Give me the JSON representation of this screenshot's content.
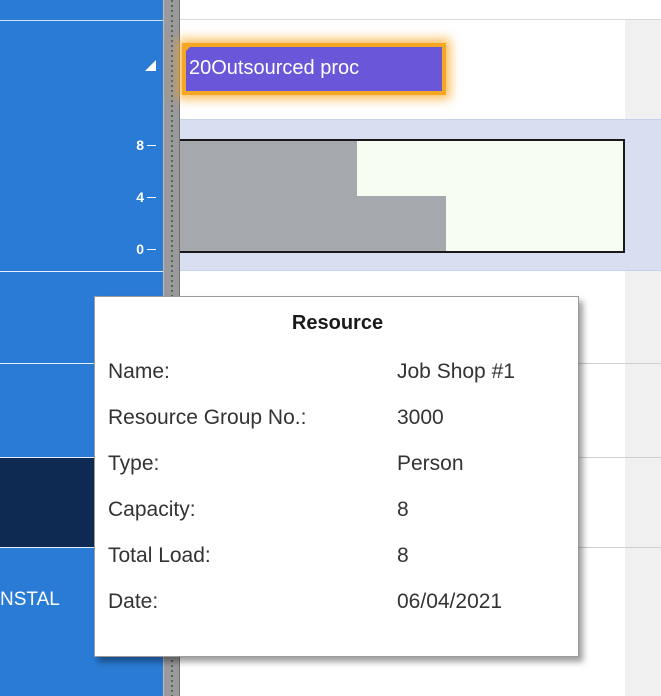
{
  "resource_pane": {
    "histogram_ticks": [
      "8",
      "4",
      "0"
    ],
    "row_label": "NSTAL"
  },
  "task_bar": {
    "label": "20Outsourced proc"
  },
  "histogram": {
    "capacity": 8,
    "load_levels": [
      {
        "from": 0.0,
        "to": 0.4,
        "value": 8
      },
      {
        "from": 0.4,
        "to": 0.6,
        "value": 4
      },
      {
        "from": 0.6,
        "to": 1.0,
        "value": 0
      }
    ],
    "ylim": [
      0,
      8
    ],
    "colors": {
      "load": "#a5a9ae",
      "free_capacity": "#f6fdf0",
      "band": "#d7dff0"
    }
  },
  "tooltip": {
    "title": "Resource",
    "rows": [
      {
        "key": "Name:",
        "value": "Job Shop #1"
      },
      {
        "key": "Resource Group No.:",
        "value": "3000"
      },
      {
        "key": "Type:",
        "value": "Person"
      },
      {
        "key": "Capacity:",
        "value": "8"
      },
      {
        "key": "Total Load:",
        "value": "8"
      },
      {
        "key": "Date:",
        "value": "06/04/2021"
      }
    ]
  },
  "colors": {
    "pane_blue": "#2a7bd6",
    "selected_row": "#0f2a52",
    "task_bar_fill": "#6a56d8",
    "task_bar_highlight": "#f5a623"
  }
}
